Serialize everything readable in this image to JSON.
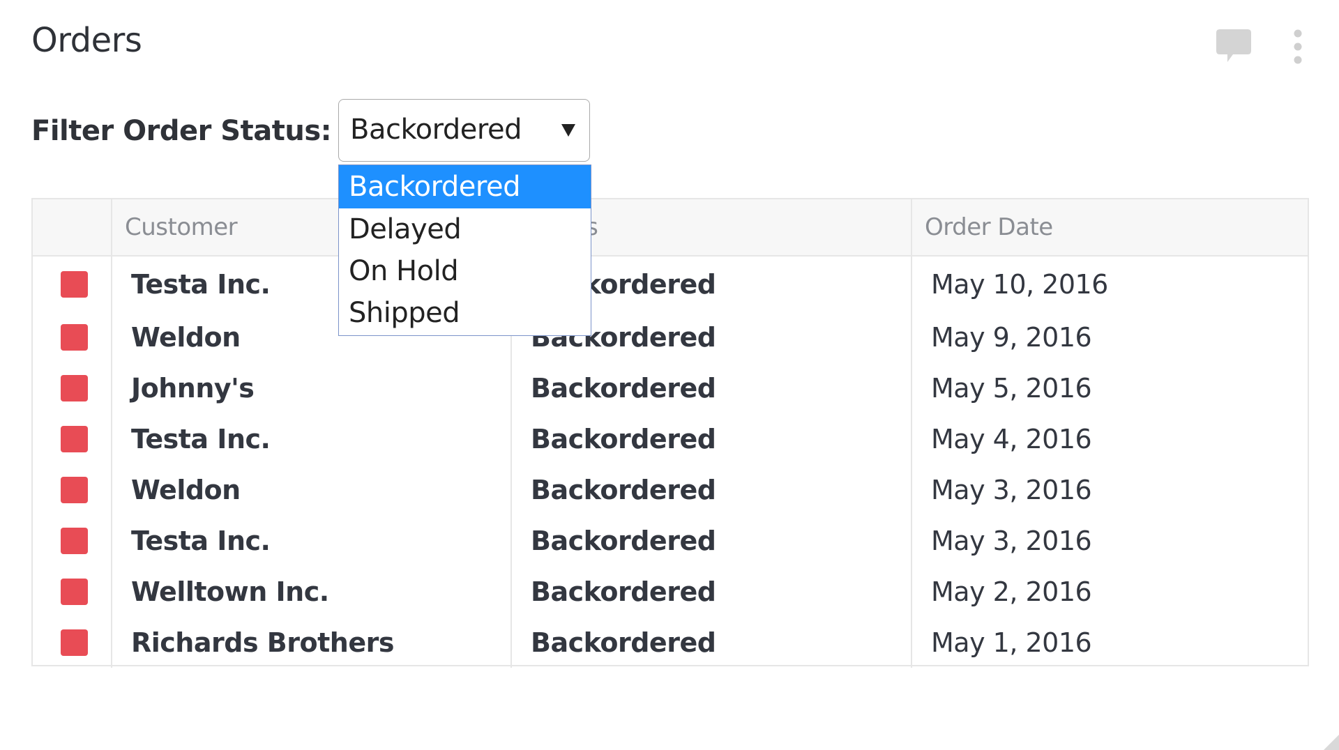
{
  "widget": {
    "title": "Orders",
    "icons": {
      "comment": "comment-icon",
      "menu": "kebab-menu-icon"
    }
  },
  "filter": {
    "label": "Filter Order Status:",
    "selected": "Backordered",
    "options": [
      "Backordered",
      "Delayed",
      "On Hold",
      "Shipped"
    ],
    "highlight_color": "#1e90ff"
  },
  "table": {
    "columns": [
      "",
      "Customer",
      "Status",
      "Order Date"
    ],
    "marker_color": "#e84c55",
    "rows": [
      {
        "customer": "Testa Inc.",
        "status": "Backordered",
        "date": "May 10, 2016"
      },
      {
        "customer": "Weldon",
        "status": "Backordered",
        "date": "May 9, 2016"
      },
      {
        "customer": "Johnny's",
        "status": "Backordered",
        "date": "May 5, 2016"
      },
      {
        "customer": "Testa Inc.",
        "status": "Backordered",
        "date": "May 4, 2016"
      },
      {
        "customer": "Weldon",
        "status": "Backordered",
        "date": "May 3, 2016"
      },
      {
        "customer": "Testa Inc.",
        "status": "Backordered",
        "date": "May 3, 2016"
      },
      {
        "customer": "Welltown Inc.",
        "status": "Backordered",
        "date": "May 2, 2016"
      },
      {
        "customer": "Richards Brothers",
        "status": "Backordered",
        "date": "May 1, 2016"
      }
    ]
  }
}
